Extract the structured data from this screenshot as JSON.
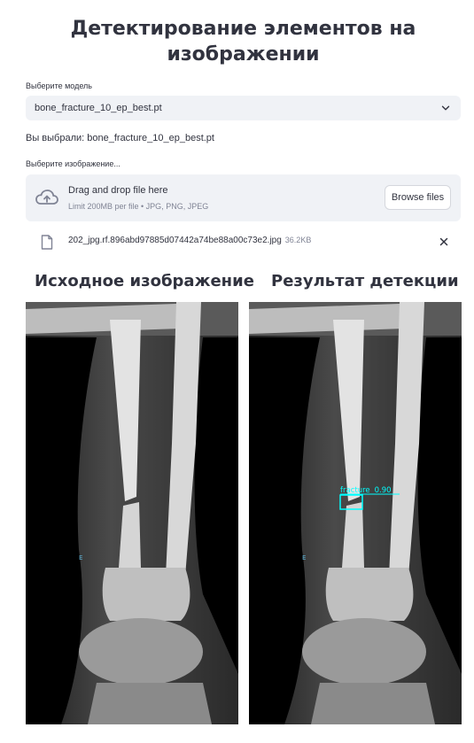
{
  "page": {
    "title_line1": "Детектирование элементов на",
    "title_line2": "изображении"
  },
  "model_select": {
    "label": "Выберите модель",
    "value": "bone_fracture_10_ep_best.pt",
    "icon": "chevron-down-icon"
  },
  "chosen_text": "Вы выбрали: bone_fracture_10_ep_best.pt",
  "uploader": {
    "label": "Выберите изображение...",
    "drop_text": "Drag and drop file here",
    "limit_text": "Limit 200MB per file • JPG, PNG, JPEG",
    "browse_label": "Browse files",
    "icon": "cloud-upload-icon"
  },
  "uploaded_file": {
    "name": "202_jpg.rf.896abd97885d07442a74be88a00c73e2.jpg",
    "size": "36.2KB",
    "icon": "file-icon",
    "remove_icon": "close-icon"
  },
  "columns": {
    "left_title": "Исходное изображение",
    "right_title": "Результат детекции"
  },
  "xray_marker": "E",
  "detection": {
    "label": "fracture",
    "confidence": "0.90",
    "color": "#00ffff"
  }
}
